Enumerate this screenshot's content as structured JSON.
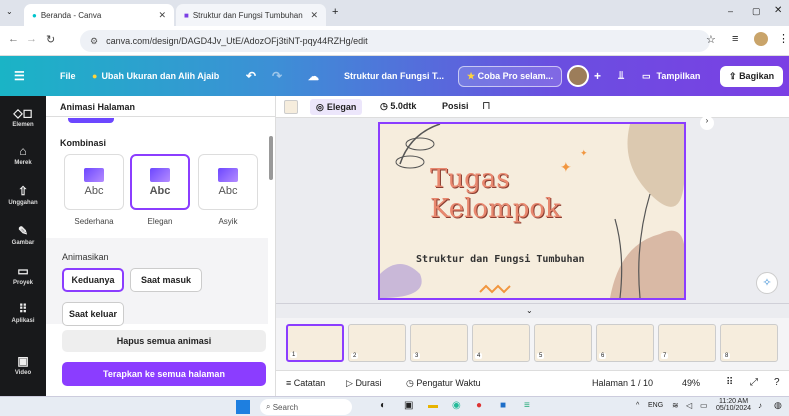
{
  "browser": {
    "tabs": [
      {
        "label": "Beranda - Canva"
      },
      {
        "label": "Struktur dan Fungsi Tumbuhan"
      }
    ],
    "new_tab": "+",
    "url": "canva.com/design/DAGD4Jv_UtE/AdozOFj3tiNT-pqy44RZHg/edit"
  },
  "topbar": {
    "file": "File",
    "resize": "Ubah Ukuran dan Alih Ajaib",
    "doc_title": "Struktur dan Fungsi T...",
    "pro": "Coba Pro selam...",
    "present": "Tampilkan",
    "share": "Bagikan"
  },
  "rail": [
    {
      "label": "Elemen"
    },
    {
      "label": "Merek"
    },
    {
      "label": "Unggahan"
    },
    {
      "label": "Gambar"
    },
    {
      "label": "Proyek"
    },
    {
      "label": "Aplikasi"
    },
    {
      "label": "Video"
    }
  ],
  "panel": {
    "title": "Animasi Halaman",
    "combo_heading": "Kombinasi",
    "cards": [
      {
        "label": "Sederhana",
        "sample": "Abc"
      },
      {
        "label": "Elegan",
        "sample": "Abc"
      },
      {
        "label": "Asyik",
        "sample": "Abc"
      }
    ],
    "animate_heading": "Animasikan",
    "options": [
      "Keduanya",
      "Saat masuk",
      "Saat keluar"
    ],
    "remove_all": "Hapus semua animasi",
    "apply_all": "Terapkan ke semua halaman"
  },
  "editor_toolbar": {
    "anim": "Elegan",
    "duration": "5.0dtk",
    "position": "Posisi"
  },
  "slide": {
    "title_line1": "Tugas",
    "title_line2": "Kelompok",
    "subtitle": "Struktur dan Fungsi Tumbuhan"
  },
  "thumbs": [
    "1",
    "2",
    "3",
    "4",
    "5",
    "6",
    "7",
    "8"
  ],
  "bottom": {
    "notes": "Catatan",
    "duration": "Durasi",
    "timer": "Pengatur Waktu",
    "page": "Halaman 1 / 10",
    "zoom": "49%"
  },
  "taskbar": {
    "search": "Search",
    "lang": "ENG",
    "time": "11:20 AM",
    "date": "05/10/2024"
  },
  "colors": {
    "accent": "#8b3dff",
    "title": "#e8886f"
  }
}
